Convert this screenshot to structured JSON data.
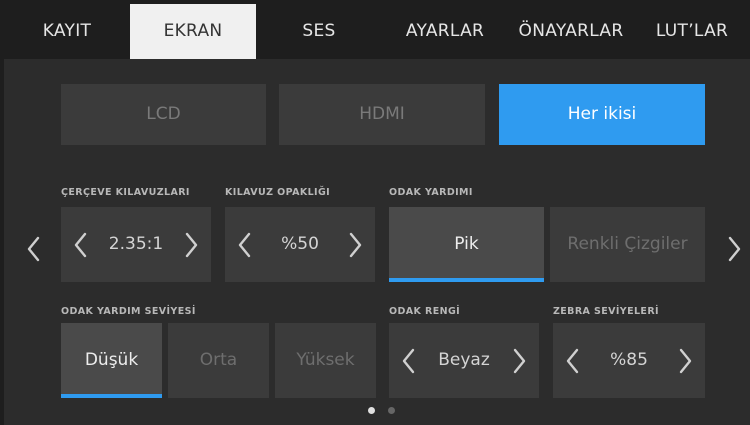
{
  "tabs": [
    {
      "label": "KAYIT",
      "active": false
    },
    {
      "label": "EKRAN",
      "active": true
    },
    {
      "label": "SES",
      "active": false
    },
    {
      "label": "AYARLAR",
      "active": false
    },
    {
      "label": "ÖNAYARLAR",
      "active": false
    },
    {
      "label": "LUT’LAR",
      "active": false
    }
  ],
  "display_target": {
    "options": [
      "LCD",
      "HDMI",
      "Her ikisi"
    ],
    "selected": "Her ikisi"
  },
  "frame_guides": {
    "label": "ÇERÇEVE KILAVUZLARI",
    "value": "2.35:1"
  },
  "guide_opacity": {
    "label": "KILAVUZ OPAKLIĞI",
    "value": "%50"
  },
  "focus_assist": {
    "label": "ODAK YARDIMI",
    "options": [
      "Pik",
      "Renkli Çizgiler"
    ],
    "selected": "Pik"
  },
  "focus_assist_level": {
    "label": "ODAK YARDIM SEVİYESİ",
    "options": [
      "Düşük",
      "Orta",
      "Yüksek"
    ],
    "selected": "Düşük"
  },
  "focus_color": {
    "label": "ODAK RENGİ",
    "value": "Beyaz"
  },
  "zebra_levels": {
    "label": "ZEBRA SEVİYELERİ",
    "value": "%85"
  },
  "pagination": {
    "pages": 2,
    "current": 1
  },
  "colors": {
    "accent": "#2f9bf0",
    "panel": "#2c2c2c",
    "control": "#3b3b3b",
    "tab_active_bg": "#f0f0f0"
  }
}
